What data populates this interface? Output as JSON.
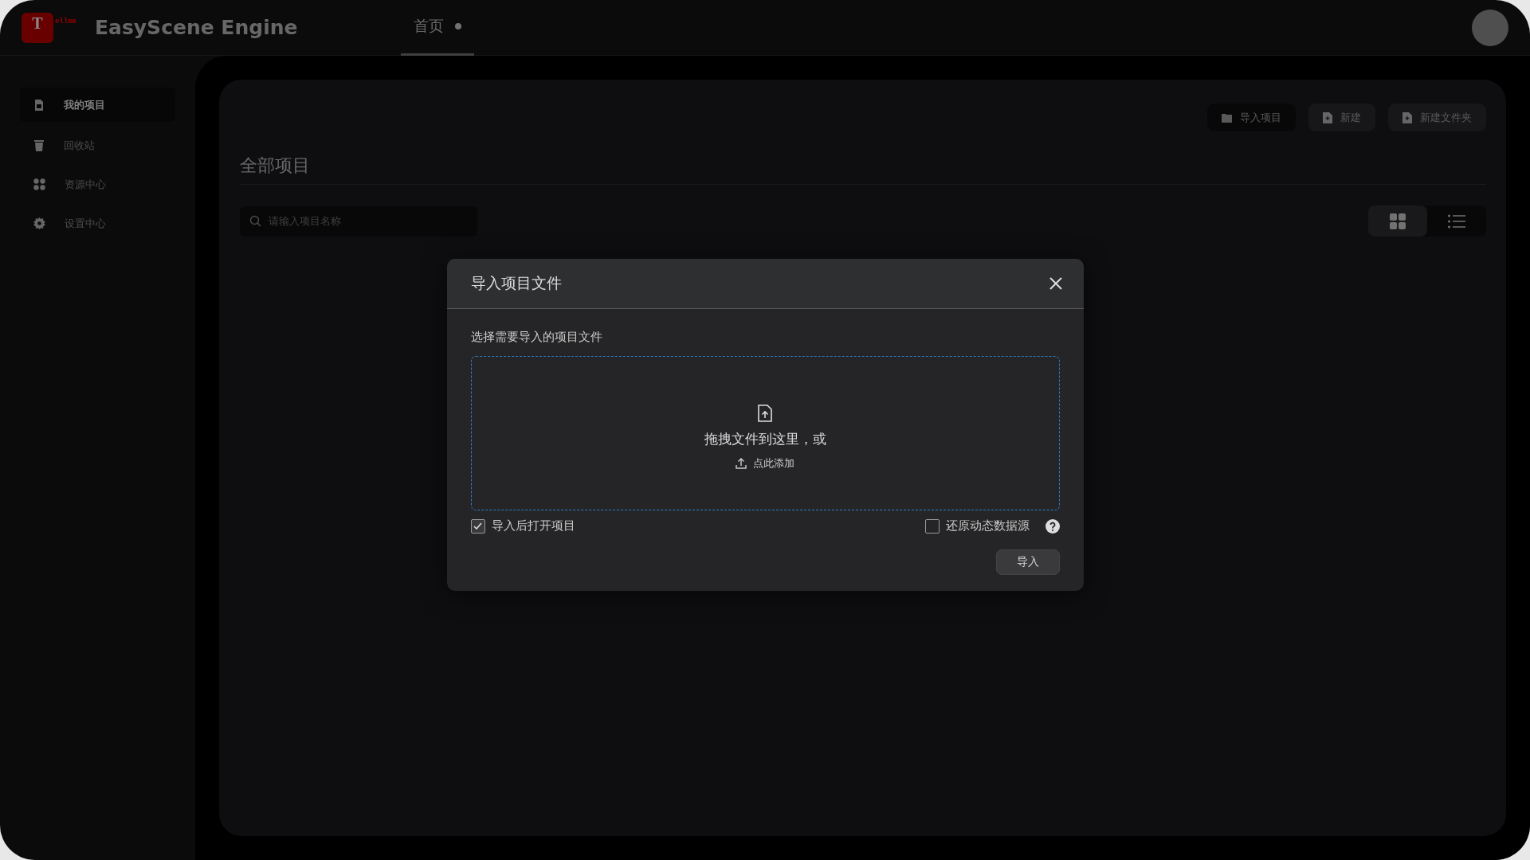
{
  "app": {
    "logo_letter": "T",
    "logo_text": "ellme",
    "title": "EasyScene Engine"
  },
  "tabs": [
    {
      "label": "首页",
      "selected": true,
      "modified": true
    }
  ],
  "sidebar": {
    "items": [
      {
        "label": "我的项目",
        "selected": true
      },
      {
        "label": "回收站",
        "selected": false
      },
      {
        "label": "资源中心",
        "selected": false
      },
      {
        "label": "设置中心",
        "selected": false
      }
    ]
  },
  "toolbar": {
    "buttons": [
      {
        "label": "导入项目",
        "kind": "dark"
      },
      {
        "label": "新建",
        "kind": "normal"
      },
      {
        "label": "新建文件夹",
        "kind": "normal"
      }
    ]
  },
  "heading": "全部项目",
  "search": {
    "placeholder": "请输入项目名称"
  },
  "view_toggle": [
    {
      "kind": "grid",
      "selected": true
    },
    {
      "kind": "list",
      "selected": false
    }
  ],
  "dialog": {
    "title": "导入项目文件",
    "label": "选择需要导入的项目文件",
    "drop_text": "拖拽文件到这里，或",
    "add_link": "点此添加",
    "options": [
      {
        "label": "导入后打开项目",
        "checked": true,
        "kind": "plain"
      },
      {
        "label": "还原动态数据源",
        "checked": false,
        "kind": "with-help"
      }
    ],
    "confirm": "导入"
  }
}
